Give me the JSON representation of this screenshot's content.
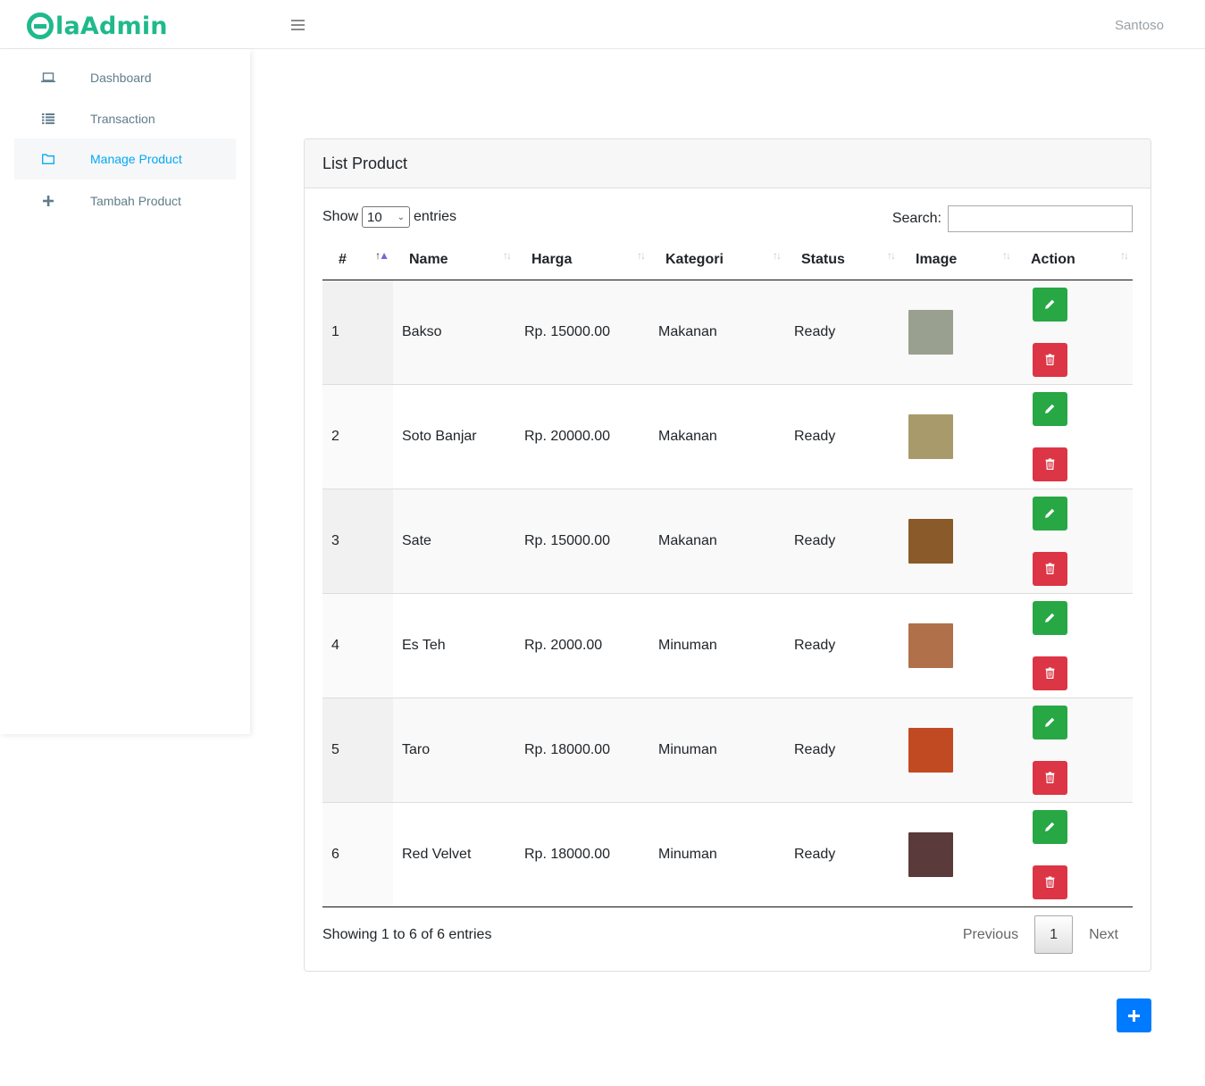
{
  "brand": {
    "logo_prefix": "la",
    "logo_suffix": "Admin"
  },
  "header": {
    "user_name": "Santoso"
  },
  "sidebar": {
    "items": [
      {
        "label": "Dashboard",
        "icon": "laptop-icon"
      },
      {
        "label": "Transaction",
        "icon": "list-icon"
      },
      {
        "label": "Manage Product",
        "icon": "folder-icon",
        "active": true
      },
      {
        "label": "Tambah Product",
        "icon": "plus-icon"
      }
    ]
  },
  "card": {
    "title": "List Product"
  },
  "datatable": {
    "show_label": "Show",
    "entries_label": "entries",
    "page_length": "10",
    "search_label": "Search:",
    "search_value": "",
    "columns": [
      "#",
      "Name",
      "Harga",
      "Kategori",
      "Status",
      "Image",
      "Action"
    ],
    "rows": [
      {
        "no": "1",
        "name": "Bakso",
        "harga": "Rp. 15000.00",
        "kategori": "Makanan",
        "status": "Ready",
        "img_color": "#9aa090"
      },
      {
        "no": "2",
        "name": "Soto Banjar",
        "harga": "Rp. 20000.00",
        "kategori": "Makanan",
        "status": "Ready",
        "img_color": "#a89a6a"
      },
      {
        "no": "3",
        "name": "Sate",
        "harga": "Rp. 15000.00",
        "kategori": "Makanan",
        "status": "Ready",
        "img_color": "#8a5a2a"
      },
      {
        "no": "4",
        "name": "Es Teh",
        "harga": "Rp. 2000.00",
        "kategori": "Minuman",
        "status": "Ready",
        "img_color": "#b0704a"
      },
      {
        "no": "5",
        "name": "Taro",
        "harga": "Rp. 18000.00",
        "kategori": "Minuman",
        "status": "Ready",
        "img_color": "#c24a22"
      },
      {
        "no": "6",
        "name": "Red Velvet",
        "harga": "Rp. 18000.00",
        "kategori": "Minuman",
        "status": "Ready",
        "img_color": "#5a3a3a"
      }
    ],
    "info": "Showing 1 to 6 of 6 entries",
    "pagination": {
      "previous": "Previous",
      "current": "1",
      "next": "Next"
    }
  },
  "colors": {
    "brand": "#1fb98c",
    "active": "#03a9f3",
    "edit": "#28a745",
    "delete": "#dc3545",
    "primary": "#007bff"
  }
}
